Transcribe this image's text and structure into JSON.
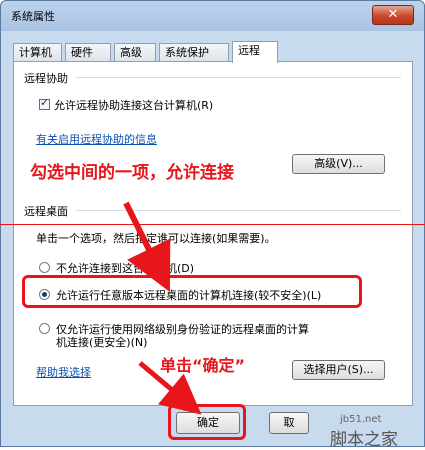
{
  "window": {
    "title": "系统属性",
    "close_glyph": "✕"
  },
  "tabs": [
    {
      "label": "计算机名"
    },
    {
      "label": "硬件"
    },
    {
      "label": "高级"
    },
    {
      "label": "系统保护"
    },
    {
      "label": "远程"
    }
  ],
  "remote_assistance": {
    "group_label": "远程协助",
    "checkbox_label": "允许远程协助连接这台计算机(R)",
    "info_link": "有关启用远程协助的信息",
    "advanced_button": "高级(V)..."
  },
  "remote_desktop": {
    "group_label": "远程桌面",
    "instruction": "单击一个选项，然后指定谁可以连接(如果需要)。",
    "option_none": "不允许连接到这台计算机(D)",
    "option_any": "允许运行任意版本远程桌面的计算机连接(较不安全)(L)",
    "option_nla_line1": "仅允许运行使用网络级别身份验证的远程桌面的计算",
    "option_nla_line2": "机连接(更安全)(N)",
    "help_link": "帮助我选择",
    "select_users_button": "选择用户(S)..."
  },
  "footer": {
    "ok_button": "确定",
    "cancel_button": "取"
  },
  "annotations": {
    "instruction_main": "勾选中间的一项，允许连接",
    "instruction_ok": "单击“确定”",
    "color": "#e8151b"
  },
  "watermark": {
    "site": "jb51.net",
    "brand": "脚本之家"
  }
}
